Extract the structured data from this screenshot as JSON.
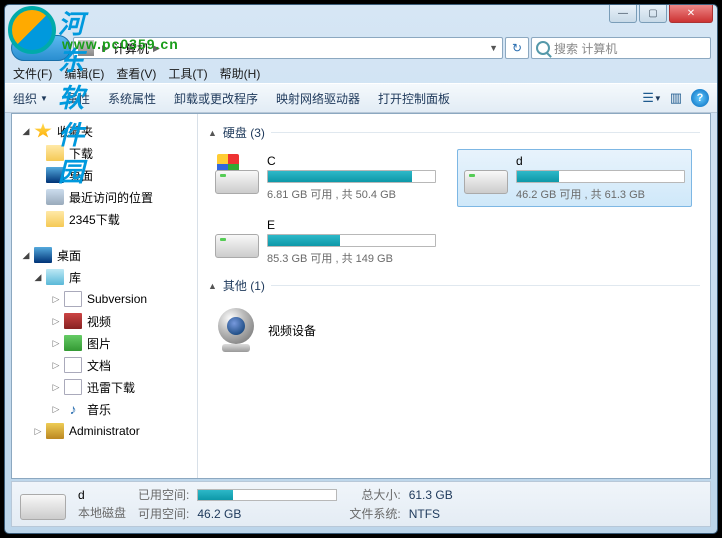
{
  "watermark": {
    "text": "河东软件园",
    "url": "www.pc0359.cn"
  },
  "breadcrumb": {
    "item": "计算机"
  },
  "search": {
    "placeholder": "搜索 计算机"
  },
  "menu": {
    "file": "文件(F)",
    "edit": "编辑(E)",
    "view": "查看(V)",
    "tools": "工具(T)",
    "help": "帮助(H)"
  },
  "toolbar": {
    "organize": "组织",
    "properties": "属性",
    "sysprops": "系统属性",
    "uninstall": "卸载或更改程序",
    "mapnet": "映射网络驱动器",
    "cpanel": "打开控制面板"
  },
  "sidebar": {
    "favorites": "收藏夹",
    "fav_items": [
      "下载",
      "桌面",
      "最近访问的位置",
      "2345下载"
    ],
    "desktop": "桌面",
    "libraries": "库",
    "lib_items": [
      "Subversion",
      "视频",
      "图片",
      "文档",
      "迅雷下载",
      "音乐"
    ],
    "admin": "Administrator"
  },
  "groups": {
    "hdd": "硬盘 (3)",
    "other": "其他 (1)"
  },
  "drives": [
    {
      "name": "C",
      "stats": "6.81 GB 可用 , 共 50.4 GB",
      "fill": 86,
      "win": true
    },
    {
      "name": "d",
      "stats": "46.2 GB 可用 , 共 61.3 GB",
      "fill": 25,
      "selected": true
    },
    {
      "name": "E",
      "stats": "85.3 GB 可用 , 共 149 GB",
      "fill": 43
    }
  ],
  "device": {
    "name": "视频设备"
  },
  "status": {
    "name": "d",
    "type": "本地磁盘",
    "used_label": "已用空间:",
    "free_label": "可用空间:",
    "free_val": "46.2 GB",
    "total_label": "总大小:",
    "total_val": "61.3 GB",
    "fs_label": "文件系统:",
    "fs_val": "NTFS",
    "fill": 25
  }
}
